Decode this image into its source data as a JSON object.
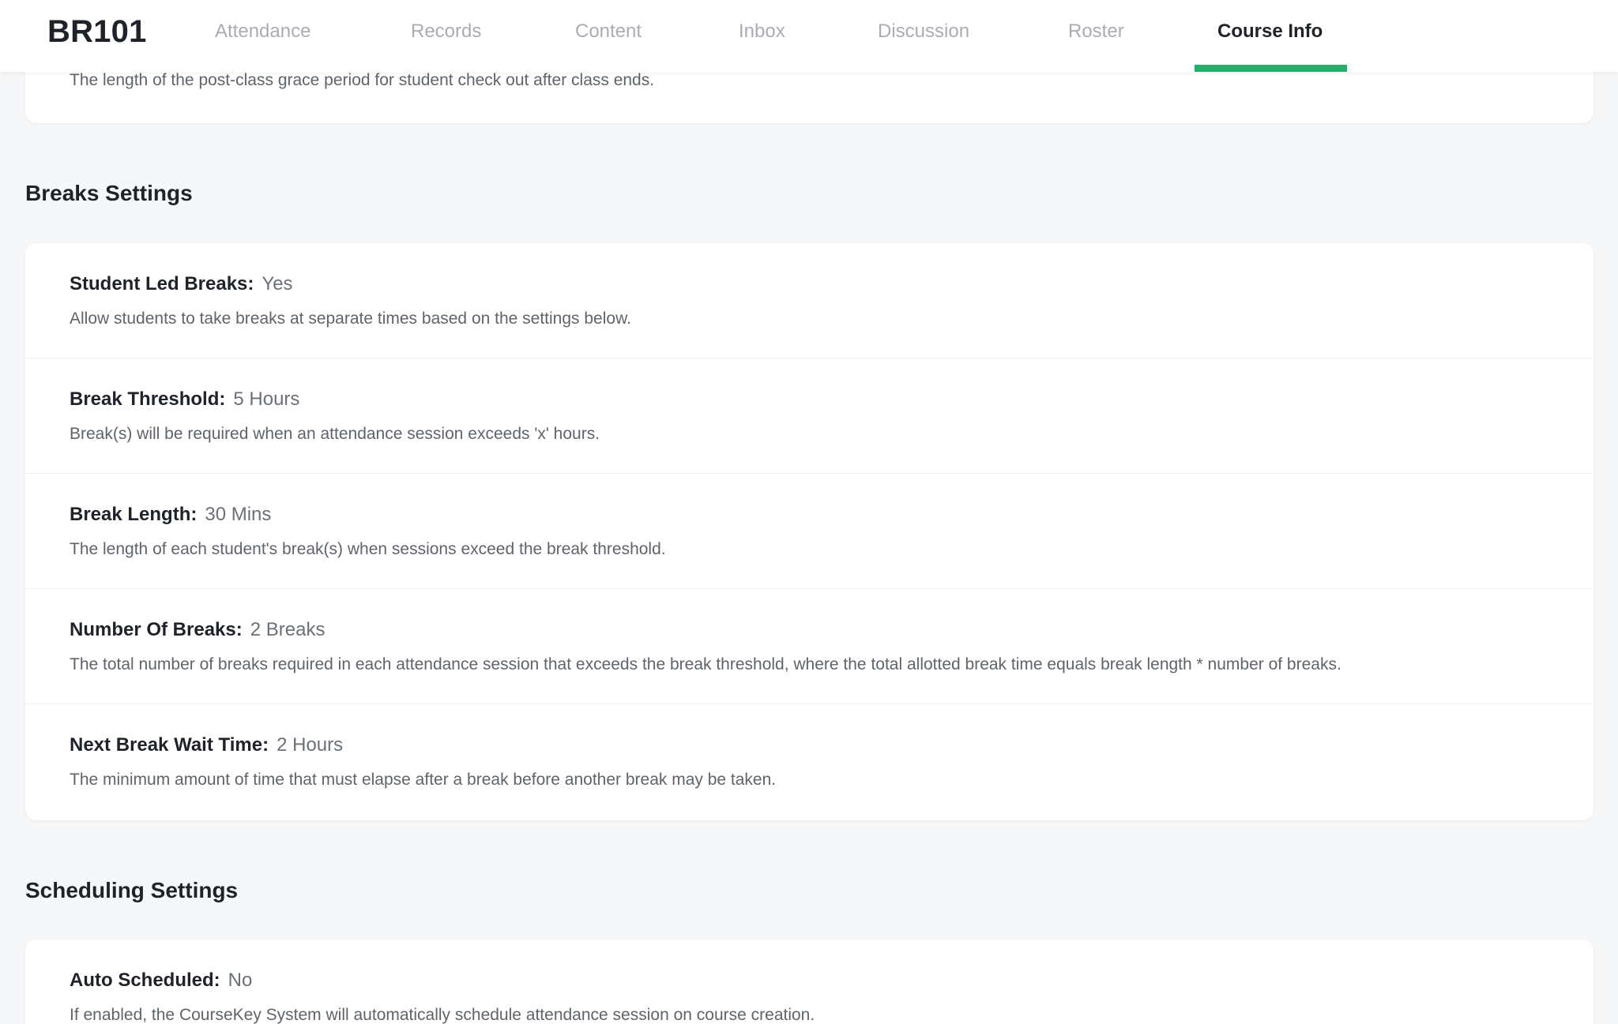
{
  "nav": {
    "course_code": "BR101",
    "tabs": [
      {
        "label": "Attendance"
      },
      {
        "label": "Records"
      },
      {
        "label": "Content"
      },
      {
        "label": "Inbox"
      },
      {
        "label": "Discussion"
      },
      {
        "label": "Roster"
      },
      {
        "label": "Course Info"
      }
    ],
    "active_tab": "Course Info",
    "accent_color": "#1fb26b"
  },
  "previous_section": {
    "description": "The length of the post-class grace period for student check out after class ends."
  },
  "breaks": {
    "title": "Breaks Settings",
    "items": [
      {
        "label": "Student Led Breaks:",
        "value": "Yes",
        "description": "Allow students to take breaks at separate times based on the settings below."
      },
      {
        "label": "Break Threshold:",
        "value": "5 Hours",
        "description": "Break(s) will be required when an attendance session exceeds 'x' hours."
      },
      {
        "label": "Break Length:",
        "value": "30 Mins",
        "description": "The length of each student's break(s) when sessions exceed the break threshold."
      },
      {
        "label": "Number Of Breaks:",
        "value": "2 Breaks",
        "description": "The total number of breaks required in each attendance session that exceeds the break threshold, where the total allotted break time equals break length * number of breaks."
      },
      {
        "label": "Next Break Wait Time:",
        "value": "2 Hours",
        "description": "The minimum amount of time that must elapse after a break before another break may be taken."
      }
    ]
  },
  "scheduling": {
    "title": "Scheduling Settings",
    "items": [
      {
        "label": "Auto Scheduled:",
        "value": "No",
        "description": "If enabled, the CourseKey System will automatically schedule attendance session on course creation."
      }
    ]
  }
}
